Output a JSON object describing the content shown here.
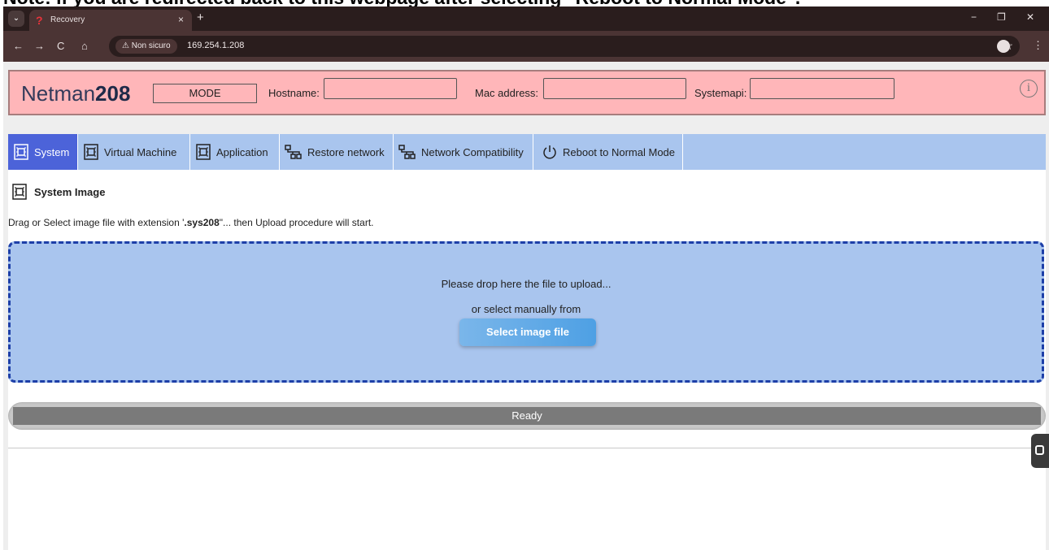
{
  "caption": "Note: if you are redirected back to this webpage after selecting \"Reboot to Normal Mode\".",
  "browser": {
    "tab_title": "Recovery",
    "tab_close": "×",
    "new_tab": "+",
    "security_label": "⚠ Non sicuro",
    "url": "169.254.1.208",
    "min": "−",
    "max": "❐",
    "close": "✕",
    "back": "←",
    "forward": "→",
    "reload": "C",
    "home": "⌂",
    "star": "☆",
    "menu": "⋮"
  },
  "header": {
    "logo_light": "Netman",
    "logo_bold": "208",
    "mode": "MODE",
    "hostname_label": "Hostname:",
    "hostname_value": "",
    "mac_label": "Mac address:",
    "mac_value": "",
    "systemapi_label": "Systemapi:",
    "systemapi_value": "",
    "info": "i"
  },
  "tabs": [
    {
      "label": "System",
      "icon": "chip-icon",
      "active": true
    },
    {
      "label": "Virtual Machine",
      "icon": "chip-icon",
      "active": false
    },
    {
      "label": "Application",
      "icon": "chip-icon",
      "active": false
    },
    {
      "label": "Restore network",
      "icon": "network-icon",
      "active": false
    },
    {
      "label": "Network Compatibility",
      "icon": "network-icon",
      "active": false
    },
    {
      "label": "Reboot to Normal Mode",
      "icon": "power-icon",
      "active": false
    }
  ],
  "content": {
    "section_title": "System Image",
    "instr_pre": "Drag or Select image file with extension '",
    "instr_ext": ".sys208",
    "instr_post": "\"... then Upload procedure will start.",
    "drop_line1": "Please drop here the file to upload...",
    "drop_line2": "or select manually from",
    "select_button": "Select image file",
    "status": "Ready",
    "progress_fraction": 1.0
  },
  "colors": {
    "header_bg": "#ffb6b9",
    "tab_active": "#4c63d9",
    "tabs_bg": "#a9c5ee",
    "dropzone_border": "#1d3fa8"
  }
}
